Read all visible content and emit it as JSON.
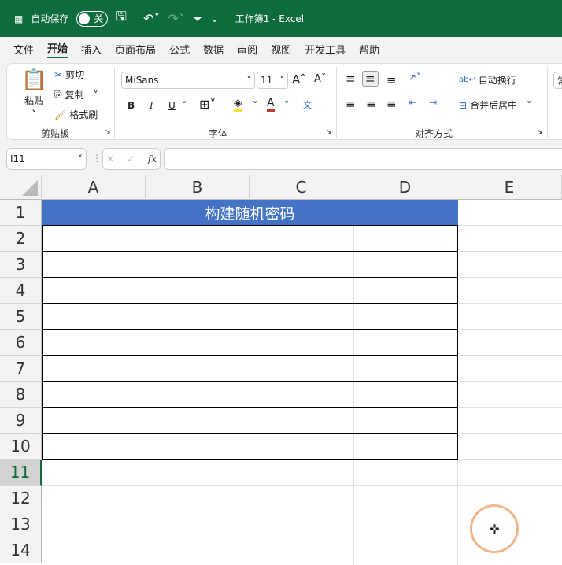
{
  "title_bar": {
    "autosave_label": "自动保存",
    "autosave_state": "关",
    "doc_title": "工作簿1  -  Excel"
  },
  "menu": [
    "文件",
    "开始",
    "插入",
    "页面布局",
    "公式",
    "数据",
    "审阅",
    "视图",
    "开发工具",
    "帮助"
  ],
  "ribbon": {
    "clipboard": {
      "paste": "粘贴",
      "cut": "剪切",
      "copy": "复制",
      "format_painter": "格式刷",
      "label": "剪贴板"
    },
    "font": {
      "name": "MiSans",
      "size": "11",
      "bold": "B",
      "italic": "I",
      "underline": "U",
      "label": "字体",
      "phonetic": "文"
    },
    "alignment": {
      "wrap": "自动换行",
      "merge": "合并后居中",
      "label": "对齐方式"
    },
    "number_partial": "常"
  },
  "formula_bar": {
    "name_box": "I11",
    "fx": "fx",
    "value": ""
  },
  "columns": [
    "A",
    "B",
    "C",
    "D",
    "E"
  ],
  "rows": [
    "1",
    "2",
    "3",
    "4",
    "5",
    "6",
    "7",
    "8",
    "9",
    "10",
    "11",
    "12",
    "13",
    "14"
  ],
  "selected_row": "11",
  "cells": {
    "A1": "构建随机密码"
  },
  "colors": {
    "header_fill": "#4472c4",
    "accent": "#0e6b3c"
  }
}
